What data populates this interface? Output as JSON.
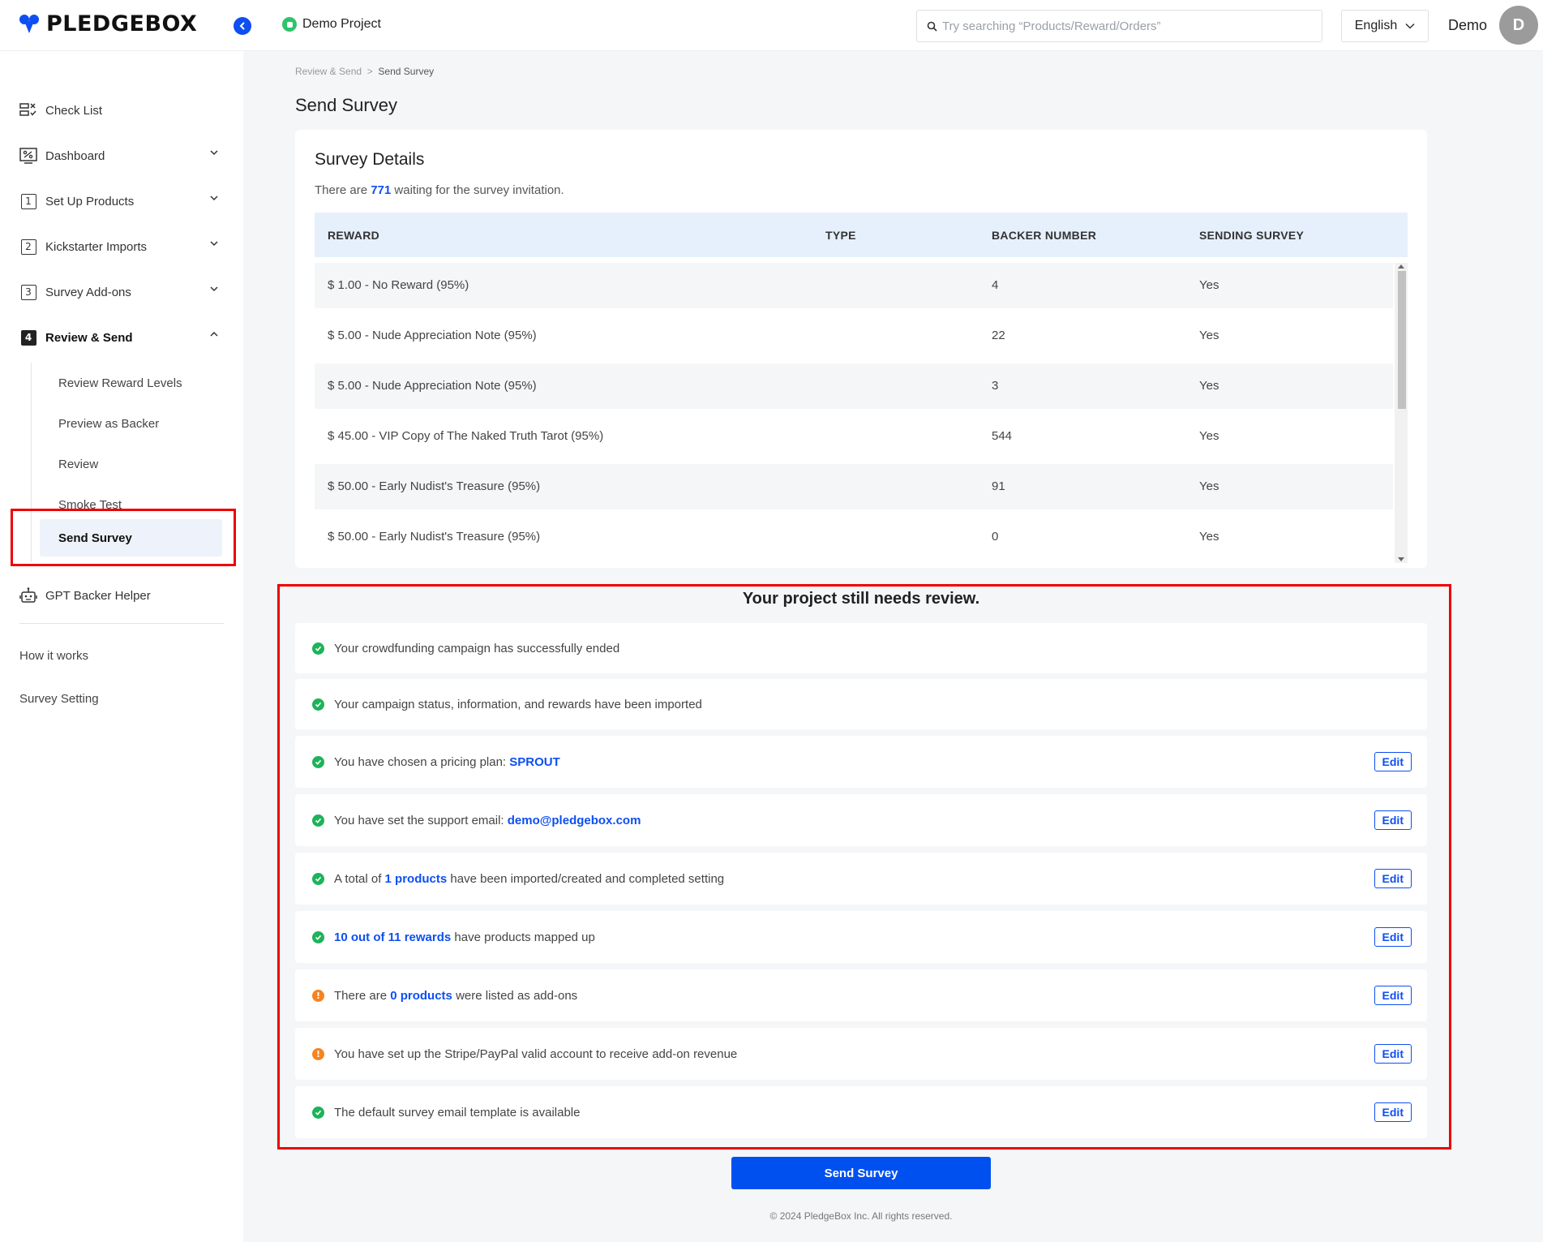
{
  "app": {
    "logo_text": "PLEDGEBOX",
    "project_name": "Demo Project"
  },
  "search": {
    "placeholder": "Try searching “Products/Reward/Orders”"
  },
  "language": {
    "selected": "English"
  },
  "user": {
    "name": "Demo",
    "initial": "D"
  },
  "sidebar": {
    "items": [
      {
        "label": "Check List",
        "icon": "checklist-icon"
      },
      {
        "label": "Dashboard",
        "icon": "dashboard-icon"
      },
      {
        "label": "Set Up Products",
        "number": "1"
      },
      {
        "label": "Kickstarter Imports",
        "number": "2"
      },
      {
        "label": "Survey Add-ons",
        "number": "3"
      },
      {
        "label": "Review & Send",
        "number": "4"
      }
    ],
    "sub_items": [
      "Review Reward Levels",
      "Preview as Backer",
      "Review",
      "Smoke Test",
      "Send Survey"
    ],
    "gpt_helper": "GPT Backer Helper",
    "how_it_works": "How it works",
    "survey_setting": "Survey Setting"
  },
  "breadcrumb": {
    "parent": "Review & Send",
    "separator": ">",
    "current": "Send Survey"
  },
  "page_title": "Send Survey",
  "survey_details": {
    "title": "Survey Details",
    "prefix": "There are ",
    "count": "771",
    "suffix": " waiting for the survey invitation.",
    "columns": [
      "REWARD",
      "TYPE",
      "BACKER NUMBER",
      "SENDING SURVEY"
    ],
    "rows": [
      {
        "reward": "$ 1.00 - No Reward (95%)",
        "type": "",
        "backers": "4",
        "sending": "Yes"
      },
      {
        "reward": "$ 5.00 - Nude Appreciation Note (95%)",
        "type": "",
        "backers": "22",
        "sending": "Yes"
      },
      {
        "reward": "$ 5.00 - Nude Appreciation Note (95%)",
        "type": "",
        "backers": "3",
        "sending": "Yes"
      },
      {
        "reward": "$ 45.00 - VIP Copy of The Naked Truth Tarot (95%)",
        "type": "",
        "backers": "544",
        "sending": "Yes"
      },
      {
        "reward": "$ 50.00 - Early Nudist's Treasure (95%)",
        "type": "",
        "backers": "91",
        "sending": "Yes"
      },
      {
        "reward": "$ 50.00 - Early Nudist's Treasure (95%)",
        "type": "",
        "backers": "0",
        "sending": "Yes"
      }
    ]
  },
  "review": {
    "title": "Your project still needs review.",
    "edit_label": "Edit",
    "items": [
      {
        "status": "ok",
        "pre": "Your crowdfunding campaign has successfully ended",
        "link": "",
        "post": ""
      },
      {
        "status": "ok",
        "pre": "Your campaign status, information, and rewards have been imported",
        "link": "",
        "post": ""
      },
      {
        "status": "ok",
        "pre": "You have chosen a pricing plan: ",
        "link": "SPROUT",
        "post": ""
      },
      {
        "status": "ok",
        "pre": "You have set the support email: ",
        "link": "demo@pledgebox.com",
        "post": ""
      },
      {
        "status": "ok",
        "pre": "A total of ",
        "link": "1 products",
        "post": " have been imported/created and completed setting"
      },
      {
        "status": "ok",
        "pre": "",
        "link": "10 out of 11 rewards",
        "post": " have products mapped up"
      },
      {
        "status": "warn",
        "pre": "There are ",
        "link": "0 products",
        "post": " were listed as add-ons"
      },
      {
        "status": "warn",
        "pre": "You have set up the Stripe/PayPal valid account to receive add-on revenue",
        "link": "",
        "post": ""
      },
      {
        "status": "ok",
        "pre": "The default survey email template is available",
        "link": "",
        "post": ""
      }
    ]
  },
  "send_button": "Send Survey",
  "footer": "© 2024 PledgeBox Inc. All rights reserved.",
  "colors": {
    "accent": "#0d4ff2",
    "success": "#1db35a",
    "warning": "#f5841f",
    "highlight": "#e00000"
  }
}
